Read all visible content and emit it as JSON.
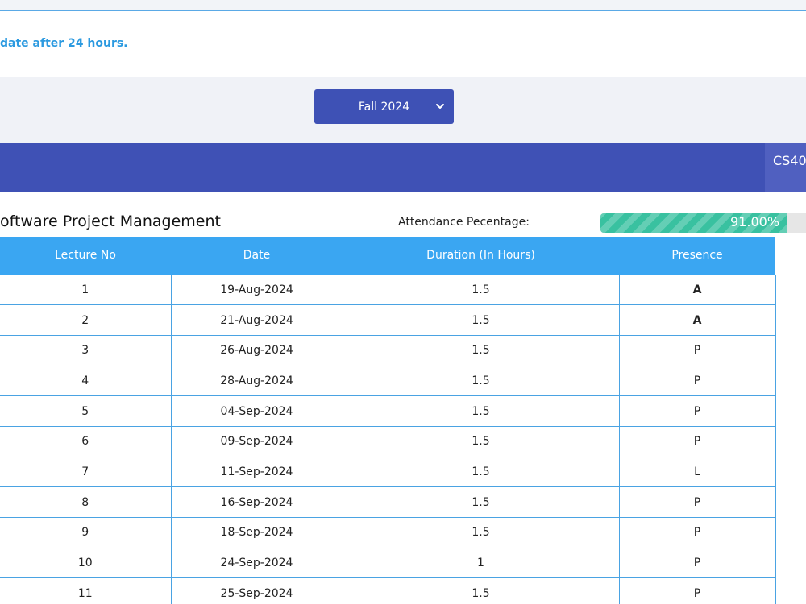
{
  "notice": {
    "text": "date after 24 hours."
  },
  "semester": {
    "selected": "Fall 2024"
  },
  "course": {
    "tab_label": "CS40",
    "title": "oftware Project Management"
  },
  "attendance": {
    "label": "Attendance Pecentage:",
    "percent": 91.0,
    "percent_text": "91.00%"
  },
  "table": {
    "headers": [
      "Lecture No",
      "Date",
      "Duration (In Hours)",
      "Presence"
    ],
    "rows": [
      [
        "1",
        "19-Aug-2024",
        "1.5",
        "A"
      ],
      [
        "2",
        "21-Aug-2024",
        "1.5",
        "A"
      ],
      [
        "3",
        "26-Aug-2024",
        "1.5",
        "P"
      ],
      [
        "4",
        "28-Aug-2024",
        "1.5",
        "P"
      ],
      [
        "5",
        "04-Sep-2024",
        "1.5",
        "P"
      ],
      [
        "6",
        "09-Sep-2024",
        "1.5",
        "P"
      ],
      [
        "7",
        "11-Sep-2024",
        "1.5",
        "L"
      ],
      [
        "8",
        "16-Sep-2024",
        "1.5",
        "P"
      ],
      [
        "9",
        "18-Sep-2024",
        "1.5",
        "P"
      ],
      [
        "10",
        "24-Sep-2024",
        "1",
        "P"
      ],
      [
        "11",
        "25-Sep-2024",
        "1.5",
        "P"
      ]
    ]
  },
  "colors": {
    "primary": "#3f51b5",
    "table_header": "#3aa6f2",
    "progress": "#39c1a0",
    "absent": "#e8475f"
  }
}
